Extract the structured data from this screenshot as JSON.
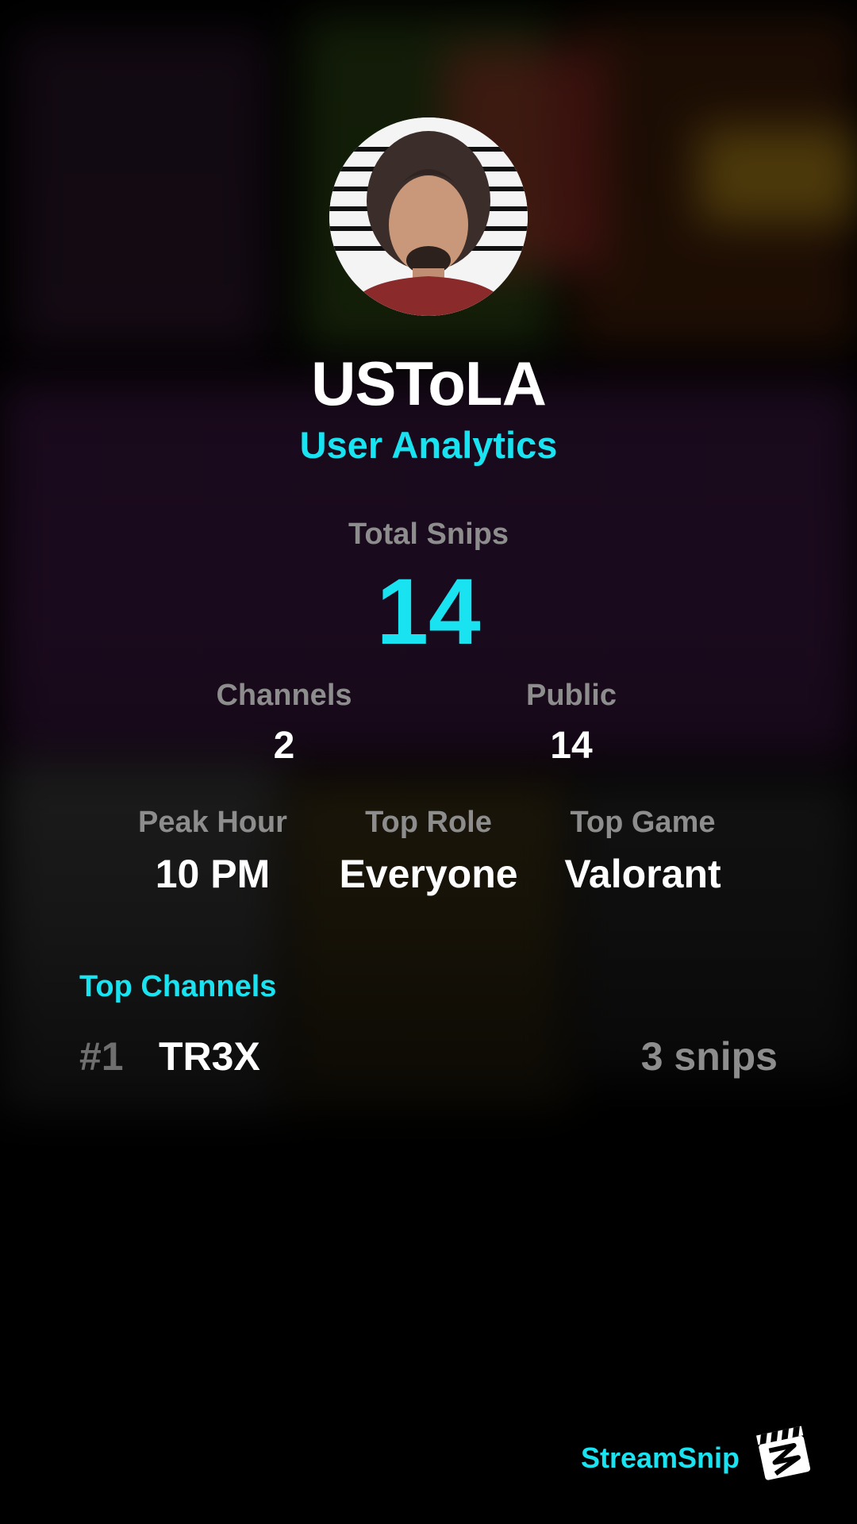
{
  "profile": {
    "username": "USToLA",
    "subtitle": "User Analytics"
  },
  "stats": {
    "total_snips_label": "Total Snips",
    "total_snips_value": "14",
    "channels_label": "Channels",
    "channels_value": "2",
    "public_label": "Public",
    "public_value": "14",
    "peak_hour_label": "Peak Hour",
    "peak_hour_value": "10 PM",
    "top_role_label": "Top Role",
    "top_role_value": "Everyone",
    "top_game_label": "Top Game",
    "top_game_value": "Valorant"
  },
  "top_channels": {
    "heading": "Top Channels",
    "items": [
      {
        "rank": "#1",
        "name": "TR3X",
        "count": "3 snips"
      }
    ]
  },
  "brand": {
    "name": "StreamSnip",
    "logo_icon": "clapperboard-icon"
  },
  "colors": {
    "accent": "#19e3f0",
    "label": "#8d8d8d",
    "background": "#000000"
  }
}
